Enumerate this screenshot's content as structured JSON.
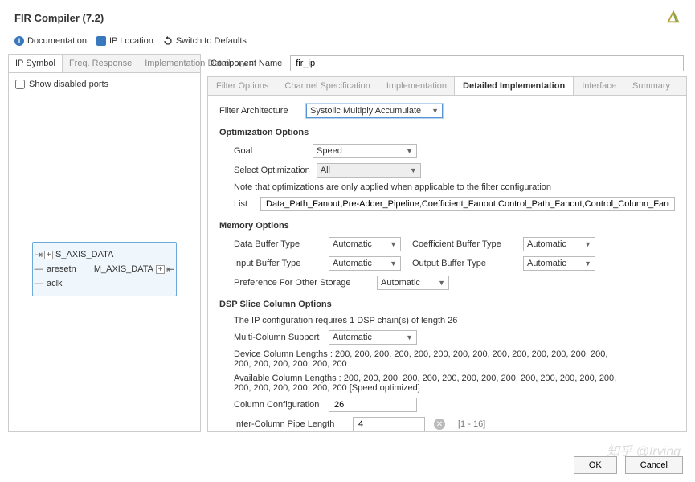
{
  "header": {
    "title": "FIR Compiler (7.2)"
  },
  "toolbar": {
    "documentation": "Documentation",
    "ip_location": "IP Location",
    "switch_defaults": "Switch to Defaults"
  },
  "left": {
    "tabs": {
      "symbol": "IP Symbol",
      "freq": "Freq. Response",
      "impl": "Implementation Detail"
    },
    "show_disabled": "Show disabled ports",
    "ports": {
      "s_axis": "S_AXIS_DATA",
      "aresetn": "aresetn",
      "m_axis": "M_AXIS_DATA",
      "aclk": "aclk"
    }
  },
  "right": {
    "component_name_label": "Component Name",
    "component_name": "fir_ip",
    "tabs": {
      "filter_options": "Filter Options",
      "channel_spec": "Channel Specification",
      "implementation": "Implementation",
      "detailed_impl": "Detailed Implementation",
      "interface": "Interface",
      "summary": "Summary"
    },
    "filter_arch_label": "Filter Architecture",
    "filter_arch": "Systolic Multiply Accumulate",
    "optimization": {
      "title": "Optimization Options",
      "goal_label": "Goal",
      "goal": "Speed",
      "select_opt_label": "Select Optimization",
      "select_opt": "All",
      "note": "Note that optimizations are only applied when applicable to the filter configuration",
      "list_label": "List",
      "list_value": "Data_Path_Fanout,Pre-Adder_Pipeline,Coefficient_Fanout,Control_Path_Fanout,Control_Column_Fanout,Control_Broadcast_Fanout,Control_LUT_Pipelin"
    },
    "memory": {
      "title": "Memory Options",
      "data_buffer_label": "Data Buffer Type",
      "data_buffer": "Automatic",
      "coeff_buffer_label": "Coefficient Buffer Type",
      "coeff_buffer": "Automatic",
      "input_buffer_label": "Input Buffer Type",
      "input_buffer": "Automatic",
      "output_buffer_label": "Output Buffer Type",
      "output_buffer": "Automatic",
      "pref_storage_label": "Preference For Other Storage",
      "pref_storage": "Automatic"
    },
    "dsp": {
      "title": "DSP Slice Column Options",
      "config_req": "The IP configuration requires 1 DSP chain(s) of length 26",
      "multi_col_label": "Multi-Column Support",
      "multi_col": "Automatic",
      "device_col": "Device Column Lengths : 200, 200, 200, 200, 200, 200, 200, 200, 200, 200, 200, 200, 200, 200, 200, 200, 200, 200, 200, 200",
      "avail_col": "Available Column Lengths : 200, 200, 200, 200, 200, 200, 200, 200, 200, 200, 200, 200, 200, 200, 200, 200, 200, 200, 200, 200 [Speed optimized]",
      "col_config_label": "Column Configuration",
      "col_config": "26",
      "pipe_len_label": "Inter-Column Pipe Length",
      "pipe_len": "4",
      "pipe_range": "[1 - 16]"
    }
  },
  "footer": {
    "ok": "OK",
    "cancel": "Cancel"
  },
  "watermark": "知乎 @Irving"
}
